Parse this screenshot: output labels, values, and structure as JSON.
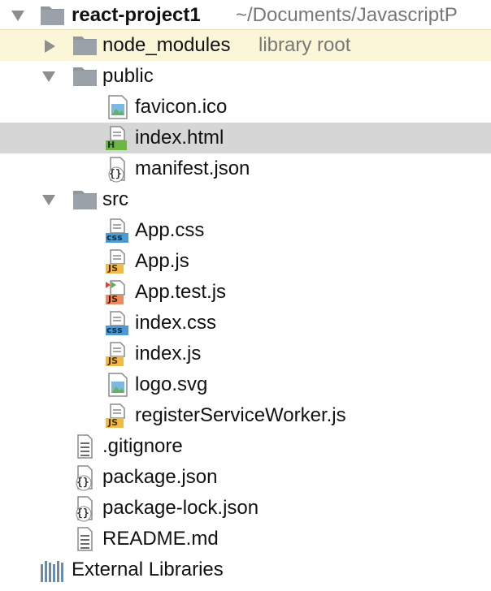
{
  "project": {
    "name": "react-project1",
    "path": "~/Documents/JavascriptP"
  },
  "tree": {
    "node_modules": {
      "label": "node_modules",
      "hint": "library root"
    },
    "public": {
      "label": "public",
      "files": [
        "favicon.ico",
        "index.html",
        "manifest.json"
      ]
    },
    "src": {
      "label": "src",
      "files": [
        "App.css",
        "App.js",
        "App.test.js",
        "index.css",
        "index.js",
        "logo.svg",
        "registerServiceWorker.js"
      ]
    },
    "root_files": [
      ".gitignore",
      "package.json",
      "package-lock.json",
      "README.md"
    ],
    "external_libraries": "External Libraries"
  },
  "badges": {
    "css": "css",
    "js": "JS",
    "html": "H",
    "json": "{}"
  },
  "colors": {
    "folder": "#8f969e",
    "selected_row": "#d6d6d6",
    "root_row": "#fbf6d8",
    "css_badge": "#4a9ad4",
    "js_badge": "#f1b84a",
    "html_badge": "#6fb544",
    "test_badge": "#e98a60"
  }
}
